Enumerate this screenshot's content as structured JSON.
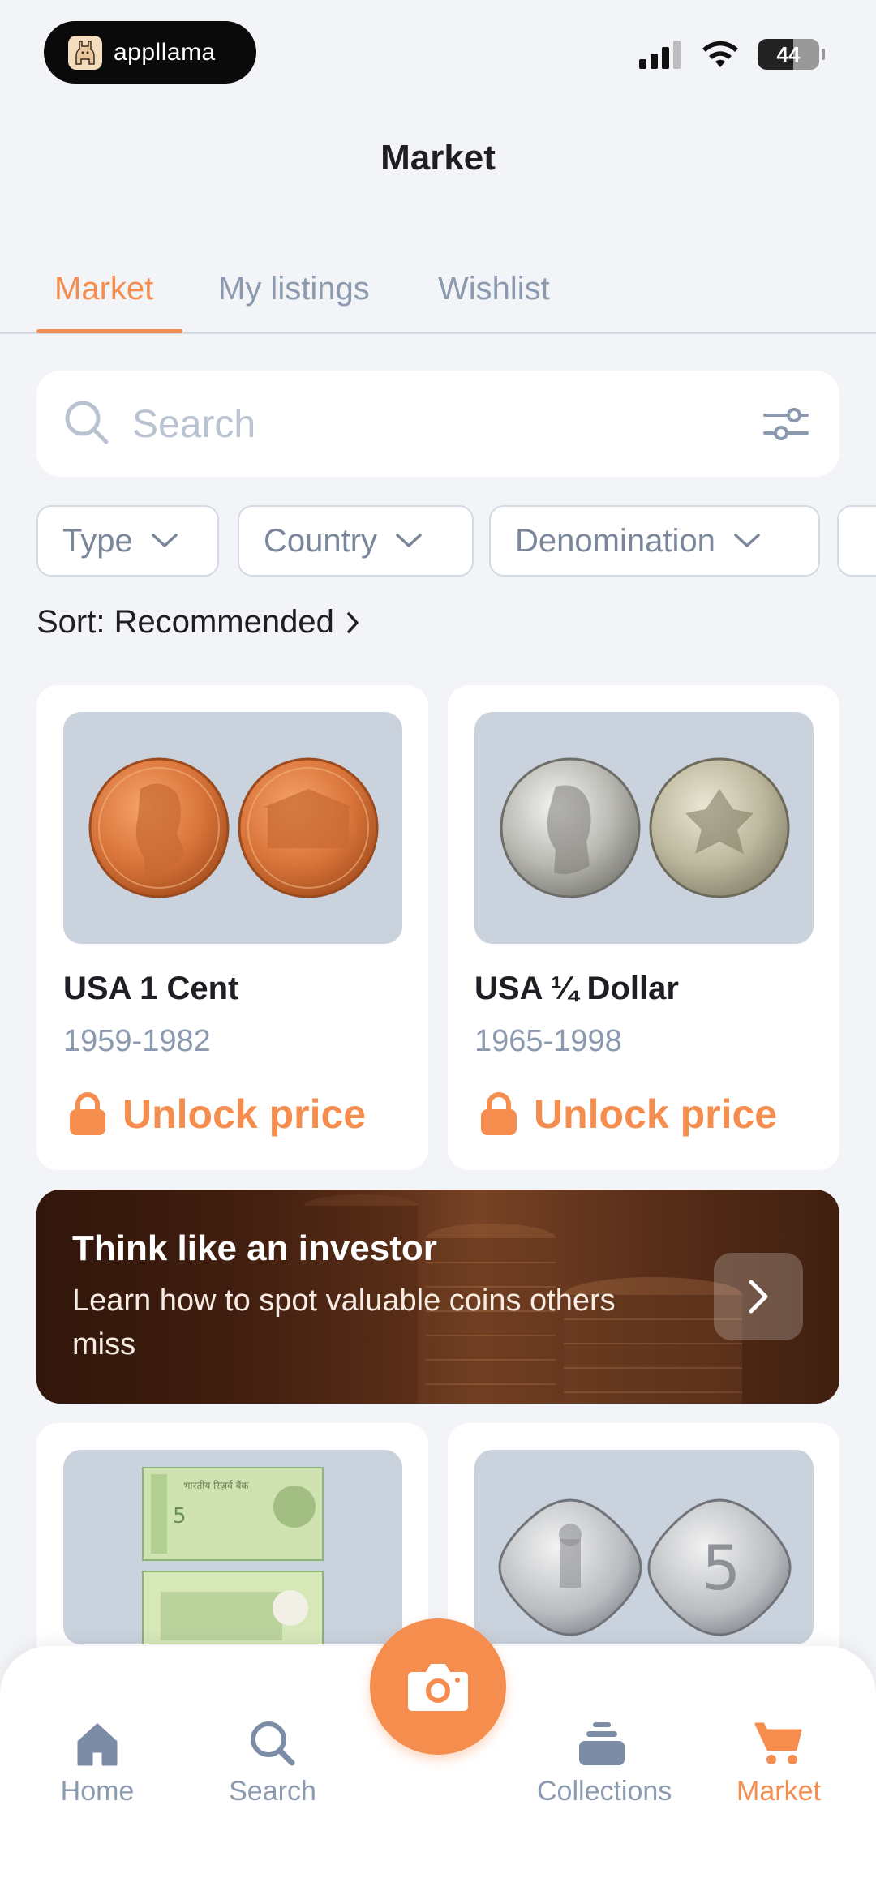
{
  "status_bar": {
    "app_name": "appllama",
    "battery": "44"
  },
  "page": {
    "title": "Market"
  },
  "tabs": [
    {
      "label": "Market",
      "active": true
    },
    {
      "label": "My listings",
      "active": false
    },
    {
      "label": "Wishlist",
      "active": false
    }
  ],
  "search": {
    "placeholder": "Search",
    "value": ""
  },
  "filters": [
    {
      "label": "Type"
    },
    {
      "label": "Country"
    },
    {
      "label": "Denomination"
    }
  ],
  "sort": {
    "label": "Sort: Recommended"
  },
  "listings": [
    {
      "name": "USA 1 Cent",
      "years": "1959-1982",
      "action": "Unlock price",
      "image": "penny-coins"
    },
    {
      "name": "USA ¼ Dollar",
      "years": "1965-1998",
      "action": "Unlock price",
      "image": "quarter-coins"
    },
    {
      "image": "india-5-rupee-banknote"
    },
    {
      "image": "india-5-paise-coins"
    }
  ],
  "banner": {
    "title": "Think like an investor",
    "subtitle": "Learn how to spot valuable coins others miss"
  },
  "bottom_nav": [
    {
      "label": "Home",
      "icon": "home-icon",
      "active": false
    },
    {
      "label": "Search",
      "icon": "search-icon",
      "active": false
    },
    {
      "label": "",
      "icon": "camera-icon",
      "active": false
    },
    {
      "label": "Collections",
      "icon": "collections-icon",
      "active": false
    },
    {
      "label": "Market",
      "icon": "cart-icon",
      "active": true
    }
  ],
  "colors": {
    "accent": "#F58D4F",
    "muted": "#8C9AB0",
    "background": "#F2F4F7"
  }
}
